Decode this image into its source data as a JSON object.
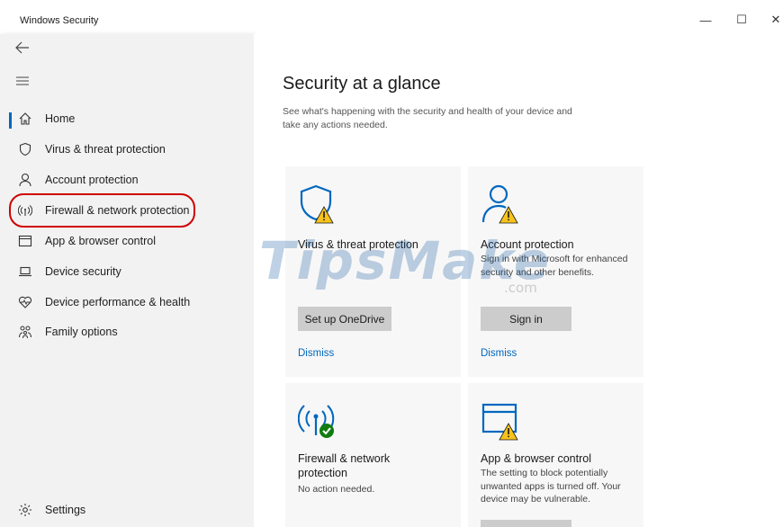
{
  "window": {
    "title": "Windows Security",
    "minimize_glyph": "—",
    "maximize_glyph": "☐",
    "close_glyph": "✕"
  },
  "sidebar": {
    "back_icon": "back-arrow-icon",
    "menu_icon": "hamburger-icon",
    "items": [
      {
        "label": "Home",
        "icon": "home-icon",
        "active": true
      },
      {
        "label": "Virus & threat protection",
        "icon": "shield-icon"
      },
      {
        "label": "Account protection",
        "icon": "person-icon"
      },
      {
        "label": "Firewall & network protection",
        "icon": "wifi-antenna-icon",
        "highlighted": true
      },
      {
        "label": "App & browser control",
        "icon": "browser-window-icon"
      },
      {
        "label": "Device security",
        "icon": "laptop-icon"
      },
      {
        "label": "Device performance & health",
        "icon": "heart-icon"
      },
      {
        "label": "Family options",
        "icon": "family-icon"
      }
    ],
    "settings": {
      "label": "Settings",
      "icon": "gear-icon"
    }
  },
  "main": {
    "title": "Security at a glance",
    "subtitle": "See what's happening with the security and health of your device and take any actions needed.",
    "cards": [
      {
        "title": "Virus & threat protection",
        "description": "",
        "button": "Set up OneDrive",
        "link": "Dismiss",
        "icon": "shield-warning-icon",
        "status": "warning"
      },
      {
        "title": "Account protection",
        "description": "Sign in with Microsoft for enhanced security and other benefits.",
        "button": "Sign in",
        "link": "Dismiss",
        "icon": "person-warning-icon",
        "status": "warning"
      },
      {
        "title": "Firewall & network protection",
        "description": "No action needed.",
        "icon": "wifi-ok-icon",
        "status": "ok"
      },
      {
        "title": "App & browser control",
        "description": "The setting to block potentially unwanted apps is turned off. Your device may be vulnerable.",
        "icon": "browser-warning-icon",
        "status": "warning"
      }
    ]
  },
  "colors": {
    "accent": "#0067c0",
    "warning": "#f6c21c",
    "ok": "#107c10",
    "highlight_ring": "#d00000",
    "sidebar_bg": "#f2f2f2",
    "card_bg": "#f7f7f7",
    "button_bg": "#cccccc"
  },
  "watermark": {
    "text": "TipsMake",
    "suffix": ".com"
  }
}
